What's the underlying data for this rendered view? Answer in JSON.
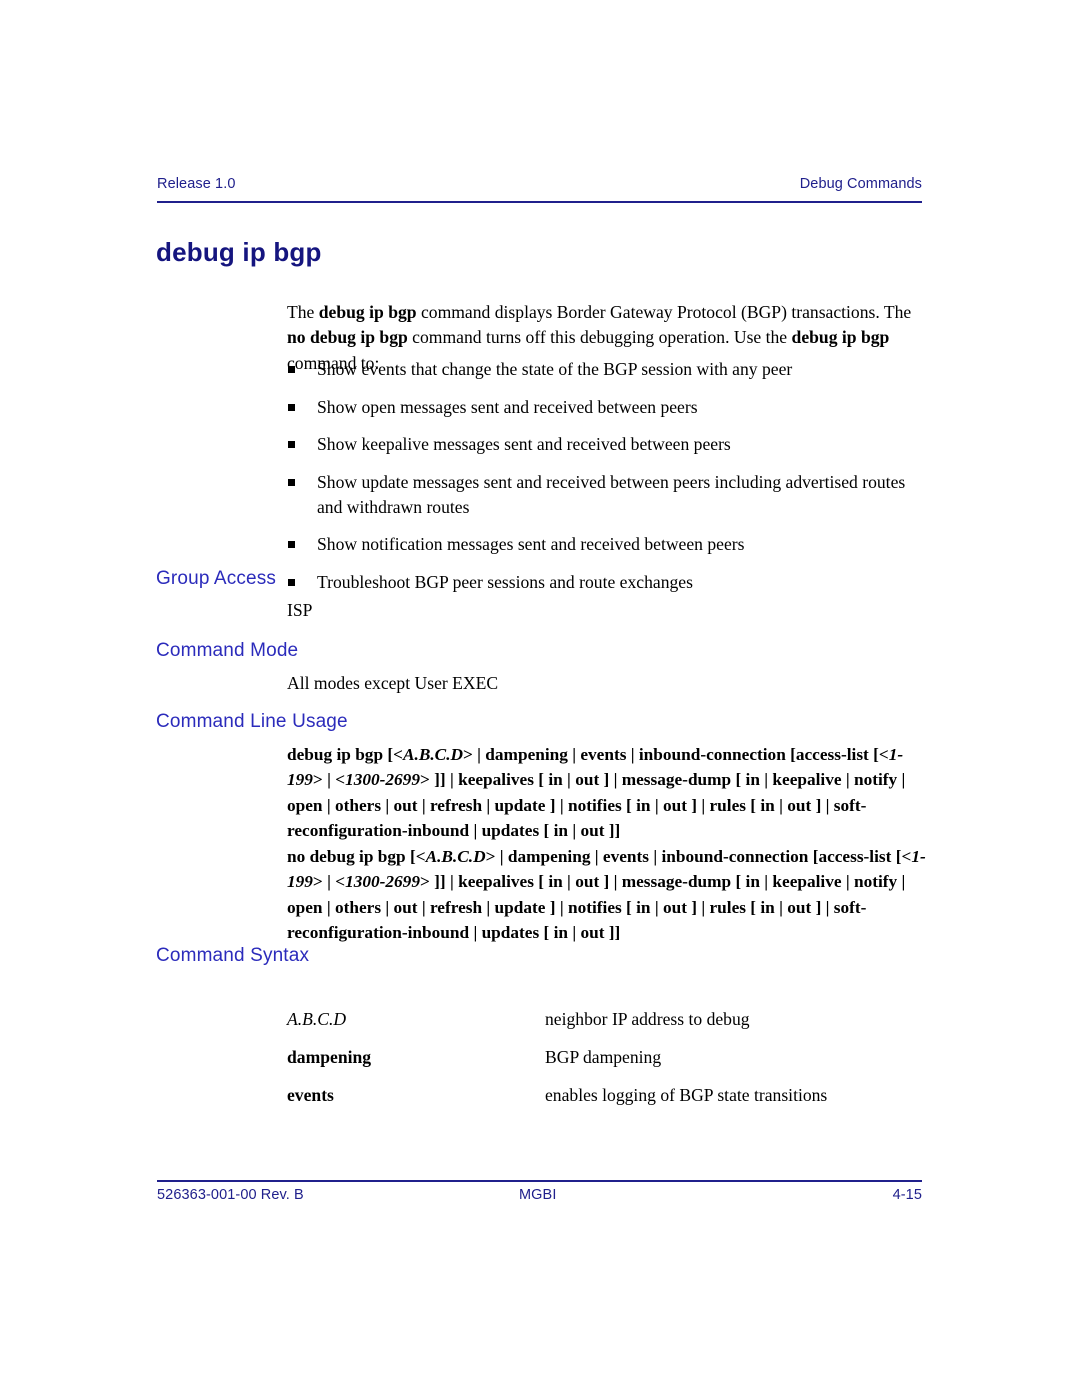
{
  "header": {
    "left": "Release 1.0",
    "right": "Debug Commands"
  },
  "title": "debug ip bgp",
  "intro": {
    "part1": "The ",
    "bold1": "debug ip bgp",
    "part2": " command displays Border Gateway Protocol (BGP) transactions. The ",
    "bold2": "no debug ip bgp",
    "part3": " command turns off this debugging operation. Use the ",
    "bold3": "debug ip bgp",
    "part4": " command to:"
  },
  "bullets": [
    "Show events that change the state of the BGP session with any peer",
    "Show open messages sent and received between peers",
    "Show keepalive messages sent and received between peers",
    "Show update messages sent and received between peers including advertised routes and withdrawn routes",
    "Show notification messages sent and received between peers",
    "Troubleshoot BGP peer sessions and route exchanges"
  ],
  "sections": {
    "group_access": {
      "heading": "Group Access",
      "body": "ISP"
    },
    "command_mode": {
      "heading": "Command Mode",
      "body": "All modes except User EXEC"
    },
    "command_line_usage": {
      "heading": "Command Line Usage",
      "debug": {
        "seg1": "debug ip bgp [<",
        "var1": "A.B.C.D",
        "seg2": "> | dampening | events |  inbound-connection [access-list [<",
        "var2": "1-199",
        "seg3": "> | <",
        "var3": "1300-2699",
        "seg4": "> ]] | keepalives [ in | out ] | message-dump [ in | keepalive | notify | open | others | out | refresh | update ] | notifies [ in | out ] | rules [ in | out ] | soft-reconfiguration-inbound | updates [ in | out ]]"
      },
      "nodebug": {
        "seg1": "no debug ip bgp [<",
        "var1": "A.B.C.D",
        "seg2": "> | dampening | events |  inbound-connection [access-list [<",
        "var2": "1-199",
        "seg3": "> | <",
        "var3": "1300-2699",
        "seg4": "> ]] | keepalives [ in | out ] | message-dump [ in | keepalive | notify | open | others | out | refresh | update ] | notifies [ in | out ] | rules [ in | out ]  | soft-reconfiguration-inbound | updates [ in | out ]]"
      }
    },
    "command_syntax": {
      "heading": "Command Syntax",
      "rows": [
        {
          "term": "A.B.C.D",
          "style": "italic",
          "desc": "neighbor IP address to debug"
        },
        {
          "term": "dampening",
          "style": "bold",
          "desc": "BGP dampening"
        },
        {
          "term": "events",
          "style": "bold",
          "desc": "enables logging of BGP state transitions"
        }
      ]
    }
  },
  "footer": {
    "left": "526363-001-00 Rev. B",
    "center": "MGBI",
    "right": "4-15"
  }
}
